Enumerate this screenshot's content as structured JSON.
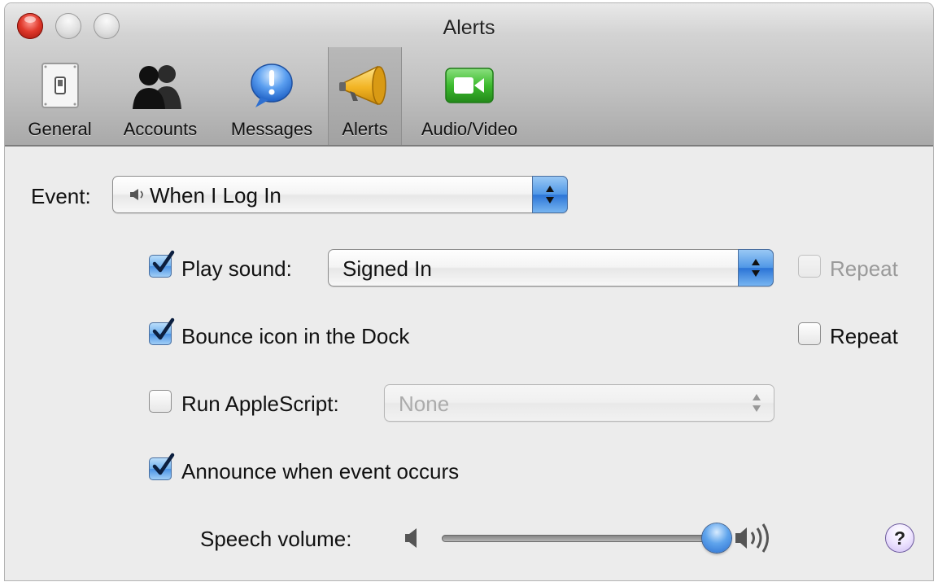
{
  "window": {
    "title": "Alerts"
  },
  "toolbar": {
    "tabs": [
      {
        "label": "General",
        "icon": "light-switch-icon"
      },
      {
        "label": "Accounts",
        "icon": "people-icon"
      },
      {
        "label": "Messages",
        "icon": "speech-bubble-alert-icon"
      },
      {
        "label": "Alerts",
        "icon": "megaphone-icon",
        "selected": true
      },
      {
        "label": "Audio/Video",
        "icon": "video-camera-icon"
      }
    ]
  },
  "event": {
    "label": "Event:",
    "selected": "When I Log In",
    "icon": "speaker-small-icon"
  },
  "options": {
    "play_sound": {
      "label": "Play sound:",
      "checked": true,
      "sound": "Signed In",
      "repeat_label": "Repeat",
      "repeat_checked": false,
      "repeat_enabled": false
    },
    "bounce_icon": {
      "label": "Bounce icon in the Dock",
      "checked": true,
      "repeat_label": "Repeat",
      "repeat_checked": false
    },
    "run_applescript": {
      "label": "Run AppleScript:",
      "checked": false,
      "script": "None",
      "enabled": false
    },
    "announce": {
      "label": "Announce when event occurs",
      "checked": true
    }
  },
  "speech_volume": {
    "label": "Speech volume:",
    "level": 1.0
  },
  "help": {
    "label": "?"
  },
  "colors": {
    "accent": "#4b92e4",
    "close_button": "#e0382b",
    "camera_green": "#3dbb2f",
    "megaphone_yellow": "#f2b424"
  }
}
